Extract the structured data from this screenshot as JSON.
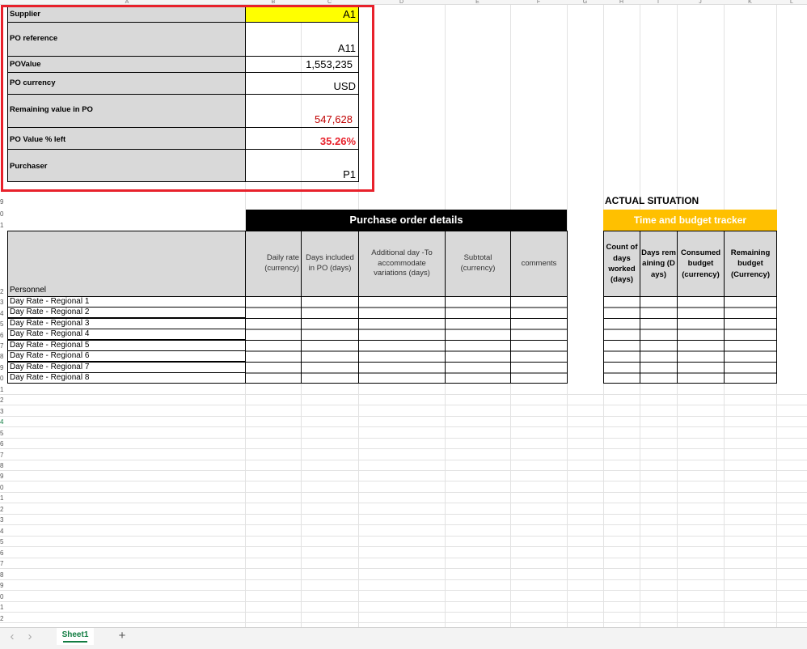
{
  "sheet": {
    "column_letters": [
      "A",
      "B",
      "C",
      "D",
      "E",
      "F",
      "G",
      "H",
      "I",
      "J",
      "K",
      "L"
    ],
    "row_numbers": [
      "9",
      "0",
      "1",
      "2",
      "3",
      "4",
      "5",
      "6",
      "7",
      "8",
      "9",
      "0",
      "1",
      "2",
      "3",
      "4",
      "5",
      "6",
      "7",
      "8",
      "9",
      "0",
      "1",
      "2",
      "3",
      "4",
      "5",
      "6",
      "7",
      "8",
      "9",
      "0",
      "1",
      "2"
    ]
  },
  "summary": [
    {
      "label": "Supplier",
      "value": "A1"
    },
    {
      "label": "PO reference",
      "value": "A11"
    },
    {
      "label": "POValue",
      "value": "1,553,235"
    },
    {
      "label": "PO currency",
      "value": "USD"
    },
    {
      "label": "Remaining value in PO",
      "value": "547,628"
    },
    {
      "label": "PO Value % left",
      "value": "35.26%"
    },
    {
      "label": "Purchaser",
      "value": "P1"
    }
  ],
  "purchase_order": {
    "banner": "Purchase order details",
    "personnel_header": "Personnel",
    "columns": [
      "Daily rate (currency)",
      "Days included in PO (days)",
      "Additional day -To accommodate variations (days)",
      "Subtotal (currency)",
      "comments"
    ],
    "rows": [
      "Day Rate - Regional 1",
      "Day Rate - Regional 2",
      "Day Rate - Regional 3",
      "Day Rate - Regional 4",
      "Day Rate - Regional 5",
      "Day Rate - Regional 6",
      "Day Rate - Regional 7",
      "Day Rate - Regional 8"
    ]
  },
  "tracker": {
    "section_title": "ACTUAL SITUATION",
    "banner": "Time and budget  tracker",
    "columns": [
      "Count of days worked (days)",
      "Days remaining (Days)",
      "Consumed budget (currency)",
      "Remaining budget (Currency)"
    ]
  },
  "tabs": {
    "active": "Sheet1",
    "add_label": "+",
    "prev_label": "‹",
    "next_label": "›"
  },
  "colors": {
    "highlight_yellow": "#ffff00",
    "header_gray": "#d9d9d9",
    "banner_black": "#000000",
    "tracker_orange": "#ffc000",
    "negative_red": "#c00000",
    "selection_red": "#e8212b",
    "tab_green": "#107c41"
  }
}
